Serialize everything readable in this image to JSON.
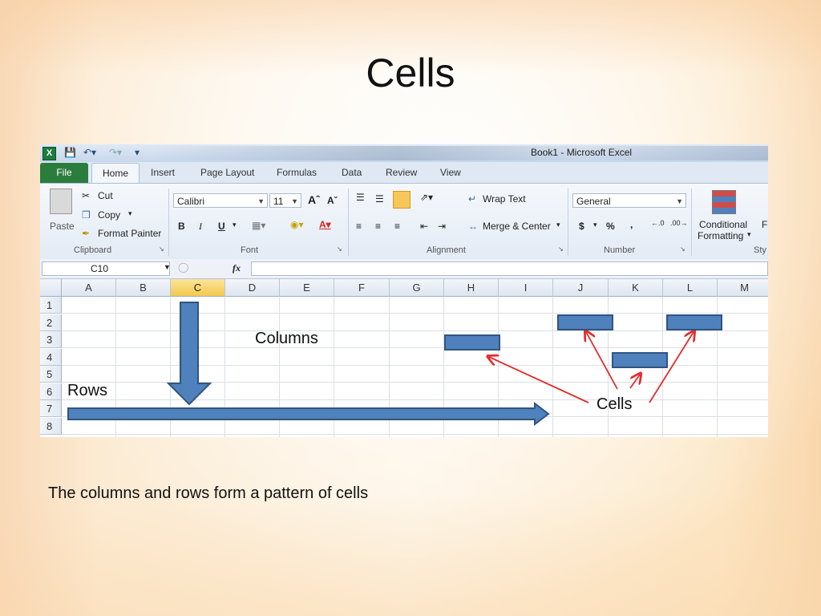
{
  "slide": {
    "title": "Cells",
    "caption": "The columns and rows form a pattern of cells"
  },
  "excel": {
    "window_title": "Book1  -  Microsoft Excel",
    "tabs": [
      "File",
      "Home",
      "Insert",
      "Page Layout",
      "Formulas",
      "Data",
      "Review",
      "View"
    ],
    "active_tab": "Home",
    "clipboard": {
      "paste": "Paste",
      "cut": "Cut",
      "copy": "Copy",
      "format_painter": "Format Painter",
      "label": "Clipboard"
    },
    "font": {
      "name": "Calibri",
      "size": "11",
      "bold": "B",
      "italic": "I",
      "underline": "U",
      "label": "Font"
    },
    "alignment": {
      "wrap_text": "Wrap Text",
      "merge_center": "Merge & Center",
      "label": "Alignment"
    },
    "number": {
      "format": "General",
      "currency": "$",
      "percent": "%",
      "comma": ",",
      "label": "Number"
    },
    "styles": {
      "conditional_1": "Conditional",
      "conditional_2": "Formatting",
      "label": "Sty"
    },
    "name_box": "C10",
    "fx": "fx",
    "columns": [
      "A",
      "B",
      "C",
      "D",
      "E",
      "F",
      "G",
      "H",
      "I",
      "J",
      "K",
      "L",
      "M"
    ],
    "selected_column": "C",
    "rows": [
      "1",
      "2",
      "3",
      "4",
      "5",
      "6",
      "7",
      "8"
    ]
  },
  "annotations": {
    "columns_label": "Columns",
    "rows_label": "Rows",
    "cells_label": "Cells"
  },
  "colors": {
    "accent": "#4f81bd",
    "arrow": "#e32b2b",
    "file_tab": "#2a7d3c"
  }
}
